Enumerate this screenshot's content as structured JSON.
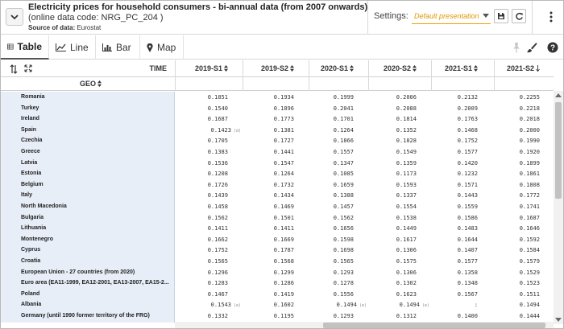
{
  "header": {
    "title": "Electricity prices for household consumers - bi-annual data (from 2007 onwards)",
    "code_line": "(online data code: NRG_PC_204 )",
    "source_label": "Source of data:",
    "source_value": "Eurostat",
    "settings_label": "Settings:",
    "presentation_value": "Default presentation"
  },
  "tabs": [
    {
      "label": "Table",
      "icon": "table-icon",
      "active": true
    },
    {
      "label": "Line",
      "icon": "line-chart-icon",
      "active": false
    },
    {
      "label": "Bar",
      "icon": "bar-chart-icon",
      "active": false
    },
    {
      "label": "Map",
      "icon": "map-pin-icon",
      "active": false
    }
  ],
  "table": {
    "time_label": "TIME",
    "geo_label": "GEO",
    "columns": [
      "2019-S1",
      "2019-S2",
      "2020-S1",
      "2020-S2",
      "2021-S1",
      "2021-S2"
    ],
    "rows": [
      {
        "geo": "Romania",
        "values": [
          "0.1851",
          "0.1934",
          "0.1999",
          "0.2006",
          "0.2132",
          "0.2255"
        ]
      },
      {
        "geo": "Turkey",
        "values": [
          "0.1540",
          "0.1896",
          "0.2041",
          "0.2088",
          "0.2009",
          "0.2218"
        ]
      },
      {
        "geo": "Ireland",
        "values": [
          "0.1687",
          "0.1773",
          "0.1701",
          "0.1814",
          "0.1763",
          "0.2018"
        ]
      },
      {
        "geo": "Spain",
        "values": [
          "0.1423",
          "0.1381",
          "0.1264",
          "0.1352",
          "0.1468",
          "0.2000"
        ],
        "flags": [
          "(d)",
          "",
          "",
          "",
          "",
          ""
        ]
      },
      {
        "geo": "Czechia",
        "values": [
          "0.1705",
          "0.1727",
          "0.1866",
          "0.1828",
          "0.1752",
          "0.1990"
        ]
      },
      {
        "geo": "Greece",
        "values": [
          "0.1383",
          "0.1441",
          "0.1557",
          "0.1549",
          "0.1577",
          "0.1920"
        ]
      },
      {
        "geo": "Latvia",
        "values": [
          "0.1536",
          "0.1547",
          "0.1347",
          "0.1359",
          "0.1420",
          "0.1899"
        ]
      },
      {
        "geo": "Estonia",
        "values": [
          "0.1208",
          "0.1264",
          "0.1085",
          "0.1173",
          "0.1232",
          "0.1861"
        ]
      },
      {
        "geo": "Belgium",
        "values": [
          "0.1726",
          "0.1732",
          "0.1659",
          "0.1593",
          "0.1571",
          "0.1808"
        ]
      },
      {
        "geo": "Italy",
        "values": [
          "0.1439",
          "0.1434",
          "0.1388",
          "0.1337",
          "0.1443",
          "0.1772"
        ]
      },
      {
        "geo": "North Macedonia",
        "values": [
          "0.1458",
          "0.1469",
          "0.1457",
          "0.1554",
          "0.1559",
          "0.1741"
        ]
      },
      {
        "geo": "Bulgaria",
        "values": [
          "0.1562",
          "0.1501",
          "0.1562",
          "0.1538",
          "0.1586",
          "0.1687"
        ]
      },
      {
        "geo": "Lithuania",
        "values": [
          "0.1411",
          "0.1411",
          "0.1656",
          "0.1449",
          "0.1483",
          "0.1646"
        ]
      },
      {
        "geo": "Montenegro",
        "values": [
          "0.1662",
          "0.1669",
          "0.1598",
          "0.1617",
          "0.1644",
          "0.1592"
        ]
      },
      {
        "geo": "Cyprus",
        "values": [
          "0.1752",
          "0.1787",
          "0.1698",
          "0.1306",
          "0.1407",
          "0.1584"
        ]
      },
      {
        "geo": "Croatia",
        "values": [
          "0.1565",
          "0.1568",
          "0.1565",
          "0.1575",
          "0.1577",
          "0.1579"
        ]
      },
      {
        "geo": "European Union - 27 countries (from 2020)",
        "values": [
          "0.1296",
          "0.1299",
          "0.1293",
          "0.1306",
          "0.1358",
          "0.1529"
        ]
      },
      {
        "geo": "Euro area (EA11-1999, EA12-2001, EA13-2007, EA15-2...",
        "values": [
          "0.1283",
          "0.1286",
          "0.1278",
          "0.1302",
          "0.1348",
          "0.1523"
        ]
      },
      {
        "geo": "Poland",
        "values": [
          "0.1467",
          "0.1419",
          "0.1556",
          "0.1623",
          "0.1567",
          "0.1511"
        ]
      },
      {
        "geo": "Albania",
        "values": [
          "0.1543",
          "0.1602",
          "0.1494",
          "0.1494",
          ":",
          "0.1494"
        ],
        "flags": [
          "(e)",
          "",
          "(e)",
          "(e)",
          "",
          ""
        ]
      },
      {
        "geo": "Germany (until 1990 former territory of the FRG)",
        "values": [
          "0.1332",
          "0.1195",
          "0.1293",
          "0.1312",
          "0.1400",
          "0.1444"
        ]
      }
    ]
  }
}
